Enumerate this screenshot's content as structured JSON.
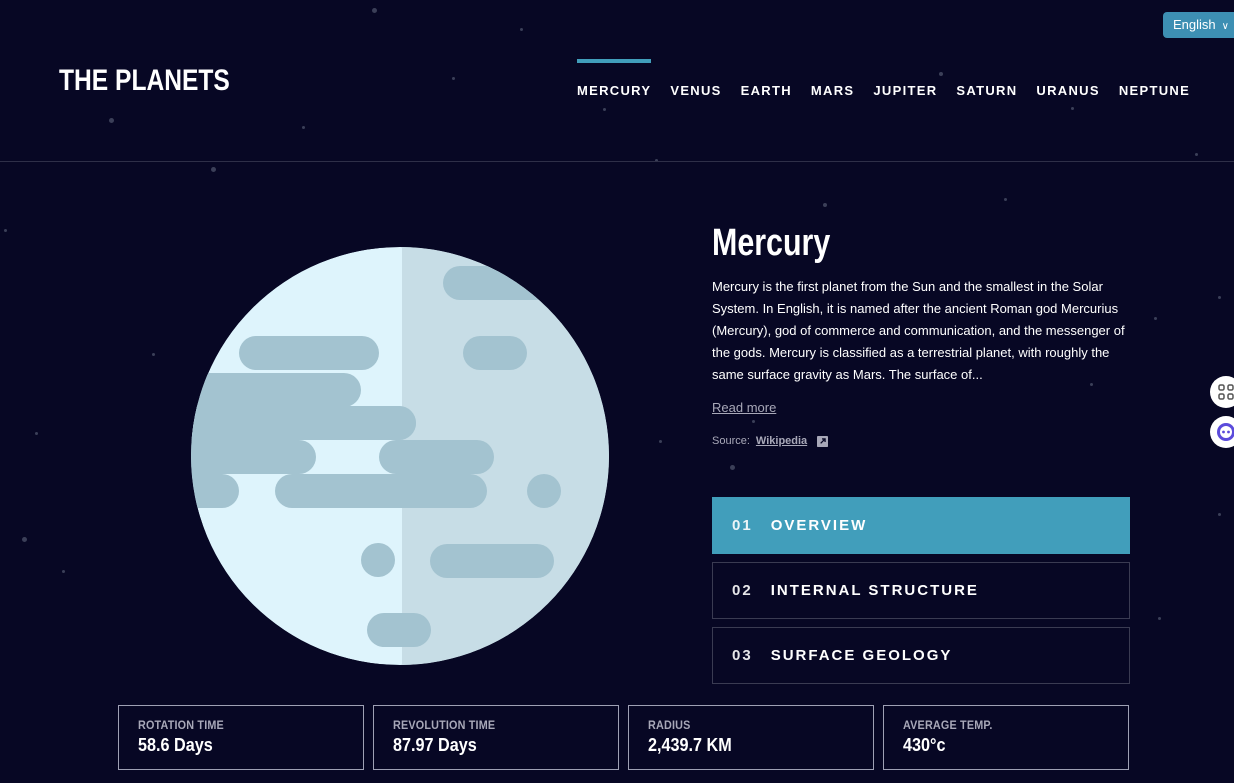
{
  "language": {
    "selected": "English"
  },
  "header": {
    "brand": "THE PLANETS",
    "nav": [
      {
        "label": "MERCURY",
        "active": true
      },
      {
        "label": "VENUS"
      },
      {
        "label": "EARTH"
      },
      {
        "label": "MARS"
      },
      {
        "label": "JUPITER"
      },
      {
        "label": "SATURN"
      },
      {
        "label": "URANUS"
      },
      {
        "label": "NEPTUNE"
      }
    ]
  },
  "planet": {
    "name": "Mercury",
    "description": "Mercury is the first planet from the Sun and the smallest in the Solar System. In English, it is named after the ancient Roman god Mercurius (Mercury), god of commerce and communication, and the messenger of the gods. Mercury is classified as a terrestrial planet, with roughly the same surface gravity as Mars. The surface of...",
    "read_more": "Read more",
    "source_label": "Source:",
    "source_link": "Wikipedia",
    "source_icon": "external-link-icon"
  },
  "tabs": [
    {
      "num": "01",
      "label": "OVERVIEW",
      "active": true
    },
    {
      "num": "02",
      "label": "INTERNAL STRUCTURE"
    },
    {
      "num": "03",
      "label": "SURFACE GEOLOGY"
    }
  ],
  "stats": [
    {
      "label": "ROTATION TIME",
      "value": "58.6 Days"
    },
    {
      "label": "REVOLUTION TIME",
      "value": "87.97 Days"
    },
    {
      "label": "RADIUS",
      "value": "2,439.7 KM"
    },
    {
      "label": "AVERAGE TEMP.",
      "value": "430°c"
    }
  ],
  "colors": {
    "background": "#070724",
    "accent": "#419ebb",
    "planet_light": "#def4fc",
    "planet_shadow": "#c7dde6",
    "planet_spots": "#a3c3d0"
  },
  "side_buttons": [
    "grid-icon",
    "assistant-icon"
  ]
}
